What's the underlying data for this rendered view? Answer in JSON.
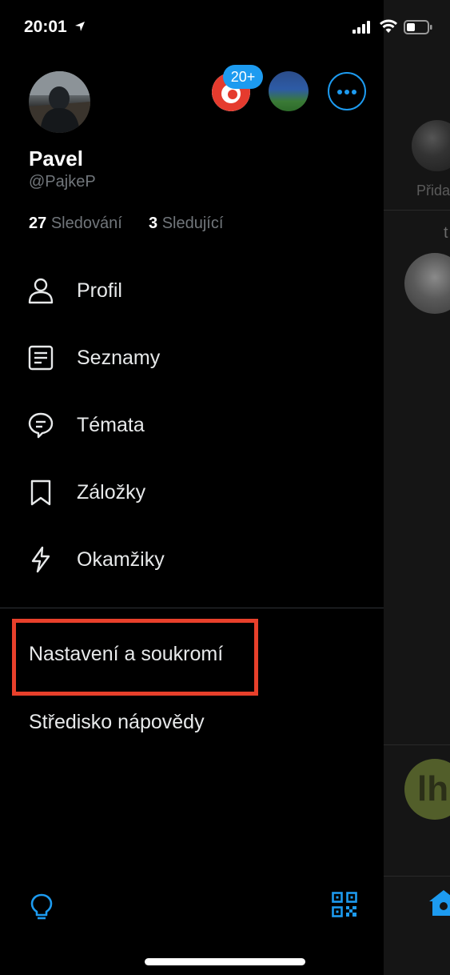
{
  "status_bar": {
    "time": "20:01"
  },
  "feed_background": {
    "story_label": "Přida",
    "partial_char": "t",
    "avatar_initials": "lh"
  },
  "profile": {
    "name": "Pavel",
    "handle": "@PajkeP",
    "following_count": "27",
    "following_label": "Sledování",
    "followers_count": "3",
    "followers_label": "Sledující",
    "notification_badge": "20+"
  },
  "menu": [
    {
      "label": "Profil",
      "icon": "person-icon"
    },
    {
      "label": "Seznamy",
      "icon": "list-icon"
    },
    {
      "label": "Témata",
      "icon": "topics-icon"
    },
    {
      "label": "Záložky",
      "icon": "bookmark-icon"
    },
    {
      "label": "Okamžiky",
      "icon": "lightning-icon"
    }
  ],
  "secondary": {
    "settings_label": "Nastavení a soukromí",
    "help_label": "Středisko nápovědy"
  },
  "colors": {
    "accent": "#1d9bf0",
    "highlight": "#e8402b",
    "background": "#000000"
  }
}
